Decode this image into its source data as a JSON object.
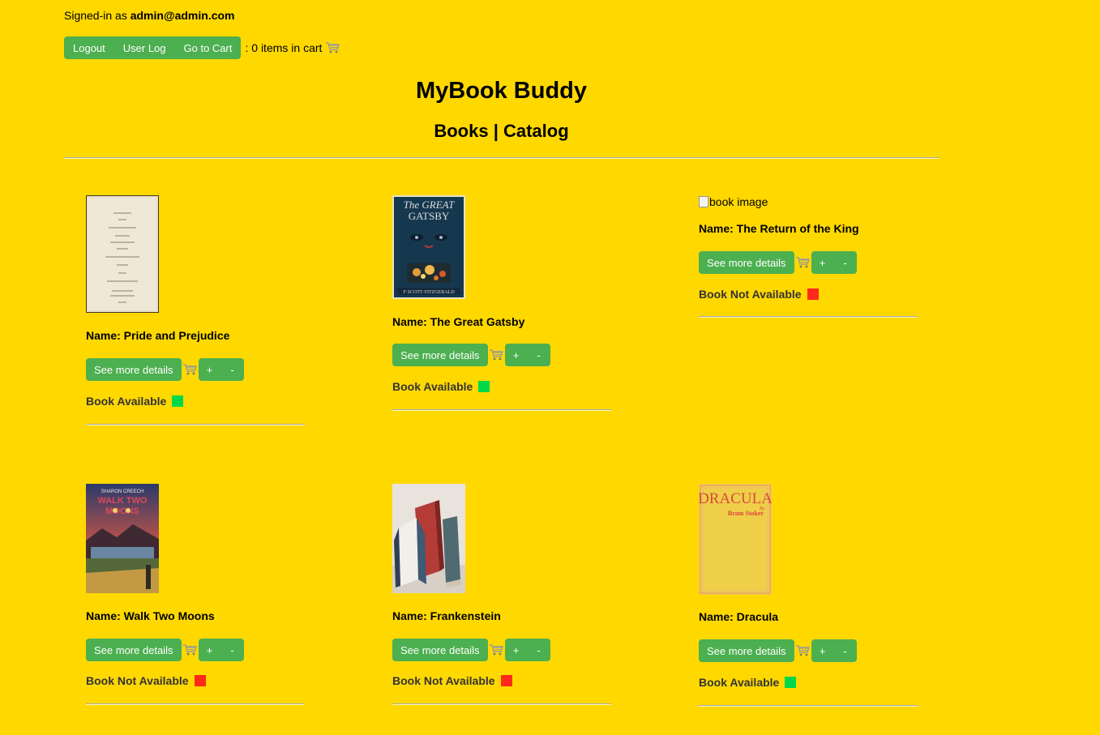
{
  "user": {
    "prefix": "Signed-in as ",
    "email": "admin@admin.com"
  },
  "nav": {
    "logout": "Logout",
    "user_log": "User Log",
    "go_to_cart": "Go to Cart",
    "cart_text": ": 0 items in cart"
  },
  "header": {
    "title": "MyBook Buddy",
    "subtitle": "Books | Catalog"
  },
  "colors": {
    "background": "#FFD800",
    "button": "#4CAF50",
    "available": "#00D84A",
    "not_available": "#FF2A1A"
  },
  "books": [
    {
      "name": "Name: Pride and Prejudice",
      "details": "See more details",
      "plus": "+",
      "minus": "-",
      "status": "Book Available",
      "available": true,
      "cover_icon": "pride-cover"
    },
    {
      "name": "Name: The Great Gatsby",
      "details": "See more details",
      "plus": "+",
      "minus": "-",
      "status": "Book Available",
      "available": true,
      "cover_icon": "gatsby-cover"
    },
    {
      "name": "Name: The Return of the King",
      "details": "See more details",
      "plus": "+",
      "minus": "-",
      "status": "Book Not Available",
      "available": false,
      "image_alt": "book image"
    },
    {
      "name": "Name: Walk Two Moons",
      "details": "See more details",
      "plus": "+",
      "minus": "-",
      "status": "Book Not Available",
      "available": false,
      "cover_icon": "moons-cover"
    },
    {
      "name": "Name: Frankenstein",
      "details": "See more details",
      "plus": "+",
      "minus": "-",
      "status": "Book Not Available",
      "available": false,
      "cover_icon": "frankenstein-cover"
    },
    {
      "name": "Name: Dracula",
      "details": "See more details",
      "plus": "+",
      "minus": "-",
      "status": "Book Available",
      "available": true,
      "cover_icon": "dracula-cover"
    }
  ]
}
